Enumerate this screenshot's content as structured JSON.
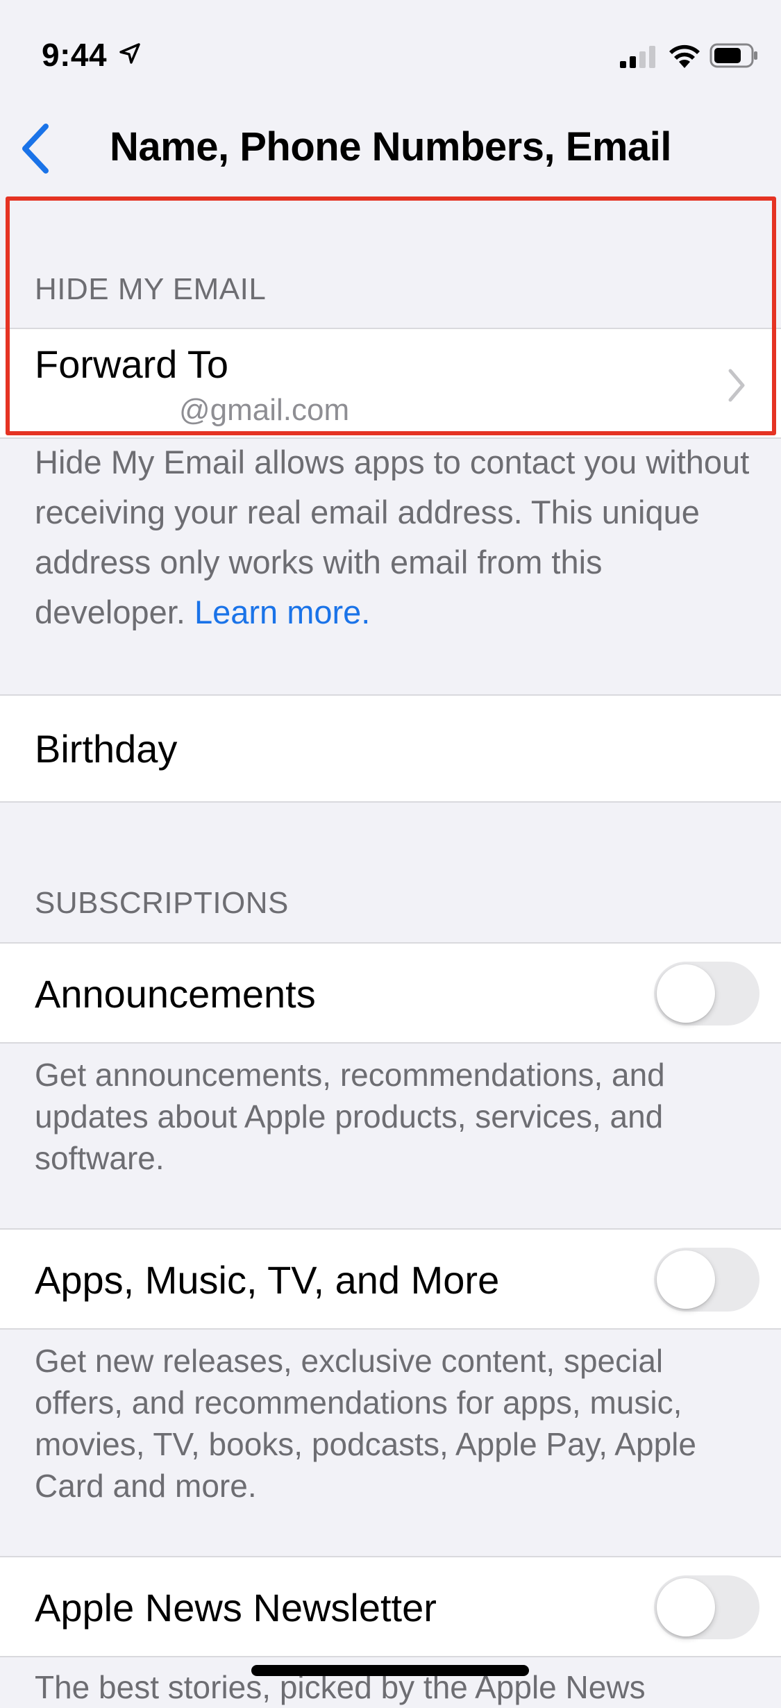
{
  "status_bar": {
    "time": "9:44"
  },
  "nav": {
    "title": "Name, Phone Numbers, Email",
    "back_icon": "chevron-left-icon"
  },
  "hide_my_email": {
    "header": "HIDE MY EMAIL",
    "forward_to_label": "Forward To",
    "forward_to_value": "@gmail.com",
    "footer_text": "Hide My Email allows apps to contact you without receiving your real email address. This unique address only works with email from this developer. ",
    "footer_link": "Learn more."
  },
  "birthday": {
    "label": "Birthday"
  },
  "subscriptions": {
    "header": "SUBSCRIPTIONS",
    "items": [
      {
        "label": "Announcements",
        "enabled": false,
        "description": "Get announcements, recommendations, and updates about Apple products, services, and software."
      },
      {
        "label": "Apps, Music, TV, and More",
        "enabled": false,
        "description": "Get new releases, exclusive content, special offers, and recommendations for apps, music, movies, TV, books, podcasts, Apple Pay, Apple Card and more."
      },
      {
        "label": "Apple News Newsletter",
        "enabled": false,
        "description": "The best stories, picked by the Apple News"
      }
    ]
  },
  "colors": {
    "accent": "#1a73e8",
    "highlight": "#e53323",
    "background": "#f2f2f7"
  }
}
